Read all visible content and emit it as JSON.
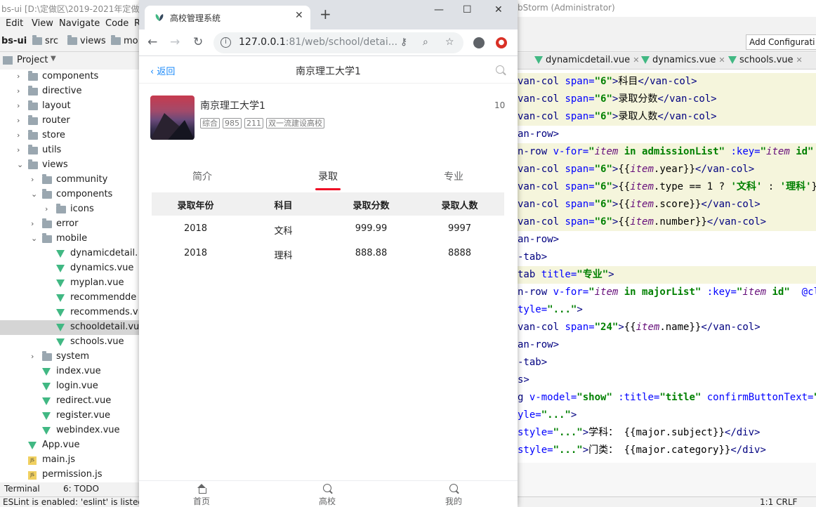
{
  "ide": {
    "title_left": "bs-ui [D:\\定做区\\2019-2021年定做\\",
    "title_right": "bStorm (Administrator)",
    "menu": [
      "Edit",
      "View",
      "Navigate",
      "Code",
      "R"
    ],
    "breadcrumbs": [
      "bs-ui",
      "src",
      "views",
      "mo"
    ],
    "add_config": "Add Configurati",
    "project_label": "Project",
    "tree": [
      {
        "label": "components",
        "type": "folder",
        "depth": 1,
        "arrow": "›"
      },
      {
        "label": "directive",
        "type": "folder",
        "depth": 1,
        "arrow": "›"
      },
      {
        "label": "layout",
        "type": "folder",
        "depth": 1,
        "arrow": "›"
      },
      {
        "label": "router",
        "type": "folder",
        "depth": 1,
        "arrow": "›"
      },
      {
        "label": "store",
        "type": "folder",
        "depth": 1,
        "arrow": "›"
      },
      {
        "label": "utils",
        "type": "folder",
        "depth": 1,
        "arrow": "›"
      },
      {
        "label": "views",
        "type": "folder",
        "depth": 1,
        "arrow": "⌄"
      },
      {
        "label": "community",
        "type": "folder",
        "depth": 2,
        "arrow": "›"
      },
      {
        "label": "components",
        "type": "folder",
        "depth": 2,
        "arrow": "⌄"
      },
      {
        "label": "icons",
        "type": "folder",
        "depth": 3,
        "arrow": "›"
      },
      {
        "label": "error",
        "type": "folder",
        "depth": 2,
        "arrow": "›"
      },
      {
        "label": "mobile",
        "type": "folder",
        "depth": 2,
        "arrow": "⌄"
      },
      {
        "label": "dynamicdetail.",
        "type": "vue",
        "depth": 3,
        "arrow": ""
      },
      {
        "label": "dynamics.vue",
        "type": "vue",
        "depth": 3,
        "arrow": ""
      },
      {
        "label": "myplan.vue",
        "type": "vue",
        "depth": 3,
        "arrow": ""
      },
      {
        "label": "recommendde",
        "type": "vue",
        "depth": 3,
        "arrow": ""
      },
      {
        "label": "recommends.v",
        "type": "vue",
        "depth": 3,
        "arrow": ""
      },
      {
        "label": "schooldetail.vu",
        "type": "vue",
        "depth": 3,
        "arrow": "",
        "selected": true
      },
      {
        "label": "schools.vue",
        "type": "vue",
        "depth": 3,
        "arrow": ""
      },
      {
        "label": "system",
        "type": "folder",
        "depth": 2,
        "arrow": "›"
      },
      {
        "label": "index.vue",
        "type": "vue",
        "depth": 2,
        "arrow": ""
      },
      {
        "label": "login.vue",
        "type": "vue",
        "depth": 2,
        "arrow": ""
      },
      {
        "label": "redirect.vue",
        "type": "vue",
        "depth": 2,
        "arrow": ""
      },
      {
        "label": "register.vue",
        "type": "vue",
        "depth": 2,
        "arrow": ""
      },
      {
        "label": "webindex.vue",
        "type": "vue",
        "depth": 2,
        "arrow": ""
      },
      {
        "label": "App.vue",
        "type": "vue",
        "depth": 1,
        "arrow": ""
      },
      {
        "label": "main.js",
        "type": "js",
        "depth": 1,
        "arrow": ""
      },
      {
        "label": "permission.js",
        "type": "js",
        "depth": 1,
        "arrow": ""
      }
    ],
    "bottom_tabs": [
      "Terminal",
      "6: TODO"
    ],
    "status_left": "ESLint is enabled: 'eslint' is listed",
    "status_right": "1:1  CRLF",
    "editor_tabs": [
      "dynamicdetail.vue",
      "dynamics.vue",
      "schools.vue"
    ],
    "code_lines": [
      [
        [
          "tk-tag",
          "van-col "
        ],
        [
          "tk-attr",
          "span="
        ],
        [
          "tk-str",
          "\"6\""
        ],
        [
          "tk-tag",
          ">"
        ],
        [
          "tk-txt",
          "科目"
        ],
        [
          "tk-tag",
          "</van-col>"
        ]
      ],
      [
        [
          "tk-tag",
          "van-col "
        ],
        [
          "tk-attr",
          "span="
        ],
        [
          "tk-str",
          "\"6\""
        ],
        [
          "tk-tag",
          ">"
        ],
        [
          "tk-txt",
          "录取分数"
        ],
        [
          "tk-tag",
          "</van-col>"
        ]
      ],
      [
        [
          "tk-tag",
          "van-col "
        ],
        [
          "tk-attr",
          "span="
        ],
        [
          "tk-str",
          "\"6\""
        ],
        [
          "tk-tag",
          ">"
        ],
        [
          "tk-txt",
          "录取人数"
        ],
        [
          "tk-tag",
          "</van-col>"
        ]
      ],
      [
        [
          "tk-tag",
          "an-row>"
        ]
      ],
      [
        [
          "tk-tag",
          "n-row "
        ],
        [
          "tk-attr",
          "v-for="
        ],
        [
          "tk-str",
          "\""
        ],
        [
          "tk-var",
          "item"
        ],
        [
          "tk-str",
          " in admissionList\""
        ],
        [
          "tk-attr",
          " :key="
        ],
        [
          "tk-str",
          "\""
        ],
        [
          "tk-var",
          "item"
        ],
        [
          "tk-str",
          " id\""
        ],
        [
          "tk-attr",
          " sty"
        ]
      ],
      [
        [
          "tk-tag",
          "van-col "
        ],
        [
          "tk-attr",
          "span="
        ],
        [
          "tk-str",
          "\"6\""
        ],
        [
          "tk-tag",
          ">"
        ],
        [
          "tk-txt",
          "{{"
        ],
        [
          "tk-var",
          "item"
        ],
        [
          "tk-txt",
          ".year}}"
        ],
        [
          "tk-tag",
          "</van-col>"
        ]
      ],
      [
        [
          "tk-tag",
          "van-col "
        ],
        [
          "tk-attr",
          "span="
        ],
        [
          "tk-str",
          "\"6\""
        ],
        [
          "tk-tag",
          ">"
        ],
        [
          "tk-txt",
          "{{"
        ],
        [
          "tk-var",
          "item"
        ],
        [
          "tk-txt",
          ".type == 1 ? "
        ],
        [
          "tk-str",
          "'文科'"
        ],
        [
          "tk-txt",
          " : "
        ],
        [
          "tk-str",
          "'理科'"
        ],
        [
          "tk-txt",
          "}}"
        ]
      ],
      [
        [
          "tk-tag",
          "van-col "
        ],
        [
          "tk-attr",
          "span="
        ],
        [
          "tk-str",
          "\"6\""
        ],
        [
          "tk-tag",
          ">"
        ],
        [
          "tk-txt",
          "{{"
        ],
        [
          "tk-var",
          "item"
        ],
        [
          "tk-txt",
          ".score}}"
        ],
        [
          "tk-tag",
          "</van-col>"
        ]
      ],
      [
        [
          "tk-tag",
          "van-col "
        ],
        [
          "tk-attr",
          "span="
        ],
        [
          "tk-str",
          "\"6\""
        ],
        [
          "tk-tag",
          ">"
        ],
        [
          "tk-txt",
          "{{"
        ],
        [
          "tk-var",
          "item"
        ],
        [
          "tk-txt",
          ".number}}"
        ],
        [
          "tk-tag",
          "</van-col>"
        ]
      ],
      [
        [
          "tk-tag",
          "an-row>"
        ]
      ],
      [
        [
          "tk-tag",
          "-tab>"
        ]
      ],
      [
        [
          "tk-tag",
          "tab "
        ],
        [
          "tk-attr",
          "title="
        ],
        [
          "tk-str",
          "\"专业\""
        ],
        [
          "tk-tag",
          ">"
        ]
      ],
      [
        [
          "tk-tag",
          "n-row "
        ],
        [
          "tk-attr",
          "v-for="
        ],
        [
          "tk-str",
          "\""
        ],
        [
          "tk-var",
          "item"
        ],
        [
          "tk-str",
          " in majorList\""
        ],
        [
          "tk-attr",
          " :key="
        ],
        [
          "tk-str",
          "\""
        ],
        [
          "tk-var",
          "item"
        ],
        [
          "tk-str",
          " id\""
        ],
        [
          "tk-attr",
          "  @click"
        ]
      ],
      [
        [
          "tk-attr",
          "tyle="
        ],
        [
          "tk-str",
          "\"...\""
        ],
        [
          "tk-tag",
          ">"
        ]
      ],
      [
        [
          "tk-tag",
          "van-col "
        ],
        [
          "tk-attr",
          "span="
        ],
        [
          "tk-str",
          "\"24\""
        ],
        [
          "tk-tag",
          ">"
        ],
        [
          "tk-txt",
          "{{"
        ],
        [
          "tk-var",
          "item"
        ],
        [
          "tk-txt",
          ".name}}"
        ],
        [
          "tk-tag",
          "</van-col>"
        ]
      ],
      [
        [
          "tk-tag",
          "an-row>"
        ]
      ],
      [
        [
          "tk-tag",
          "-tab>"
        ]
      ],
      [
        [
          "tk-tag",
          "s>"
        ]
      ],
      [
        [
          "tk-tag",
          "g "
        ],
        [
          "tk-attr",
          "v-model="
        ],
        [
          "tk-str",
          "\"show\""
        ],
        [
          "tk-attr",
          " :title="
        ],
        [
          "tk-str",
          "\"title\""
        ],
        [
          "tk-attr",
          " confirmButtonText="
        ],
        [
          "tk-str",
          "\"关"
        ]
      ],
      [
        [
          "tk-attr",
          "yle="
        ],
        [
          "tk-str",
          "\"...\""
        ],
        [
          "tk-tag",
          ">"
        ]
      ],
      [
        [
          "tk-attr",
          "style="
        ],
        [
          "tk-str",
          "\"...\""
        ],
        [
          "tk-tag",
          ">"
        ],
        [
          "tk-txt",
          "学科： {{major.subject}}"
        ],
        [
          "tk-tag",
          "</div>"
        ]
      ],
      [
        [
          "tk-attr",
          "style="
        ],
        [
          "tk-str",
          "\"...\""
        ],
        [
          "tk-tag",
          ">"
        ],
        [
          "tk-txt",
          "门类： {{major.category}}"
        ],
        [
          "tk-tag",
          "</div>"
        ]
      ]
    ]
  },
  "browser": {
    "tab_title": "高校管理系统",
    "url_host": "127.0.0.1",
    "url_rest": ":81/web/school/detai...",
    "colors": {
      "accent": "#ee0a24",
      "link": "#1989fa"
    }
  },
  "app": {
    "nav": {
      "back": "返回",
      "title": "南京理工大学1"
    },
    "school": {
      "name": "南京理工大学1",
      "tags": [
        "综合",
        "985",
        "211",
        "双一流建设高校"
      ],
      "count": "10"
    },
    "tabs": [
      {
        "label": "简介",
        "active": false
      },
      {
        "label": "录取",
        "active": true
      },
      {
        "label": "专业",
        "active": false
      }
    ],
    "table": {
      "headers": [
        "录取年份",
        "科目",
        "录取分数",
        "录取人数"
      ],
      "rows": [
        [
          "2018",
          "文科",
          "999.99",
          "9997"
        ],
        [
          "2018",
          "理科",
          "888.88",
          "8888"
        ]
      ]
    },
    "tabbar": [
      "首页",
      "高校",
      "我的"
    ]
  }
}
